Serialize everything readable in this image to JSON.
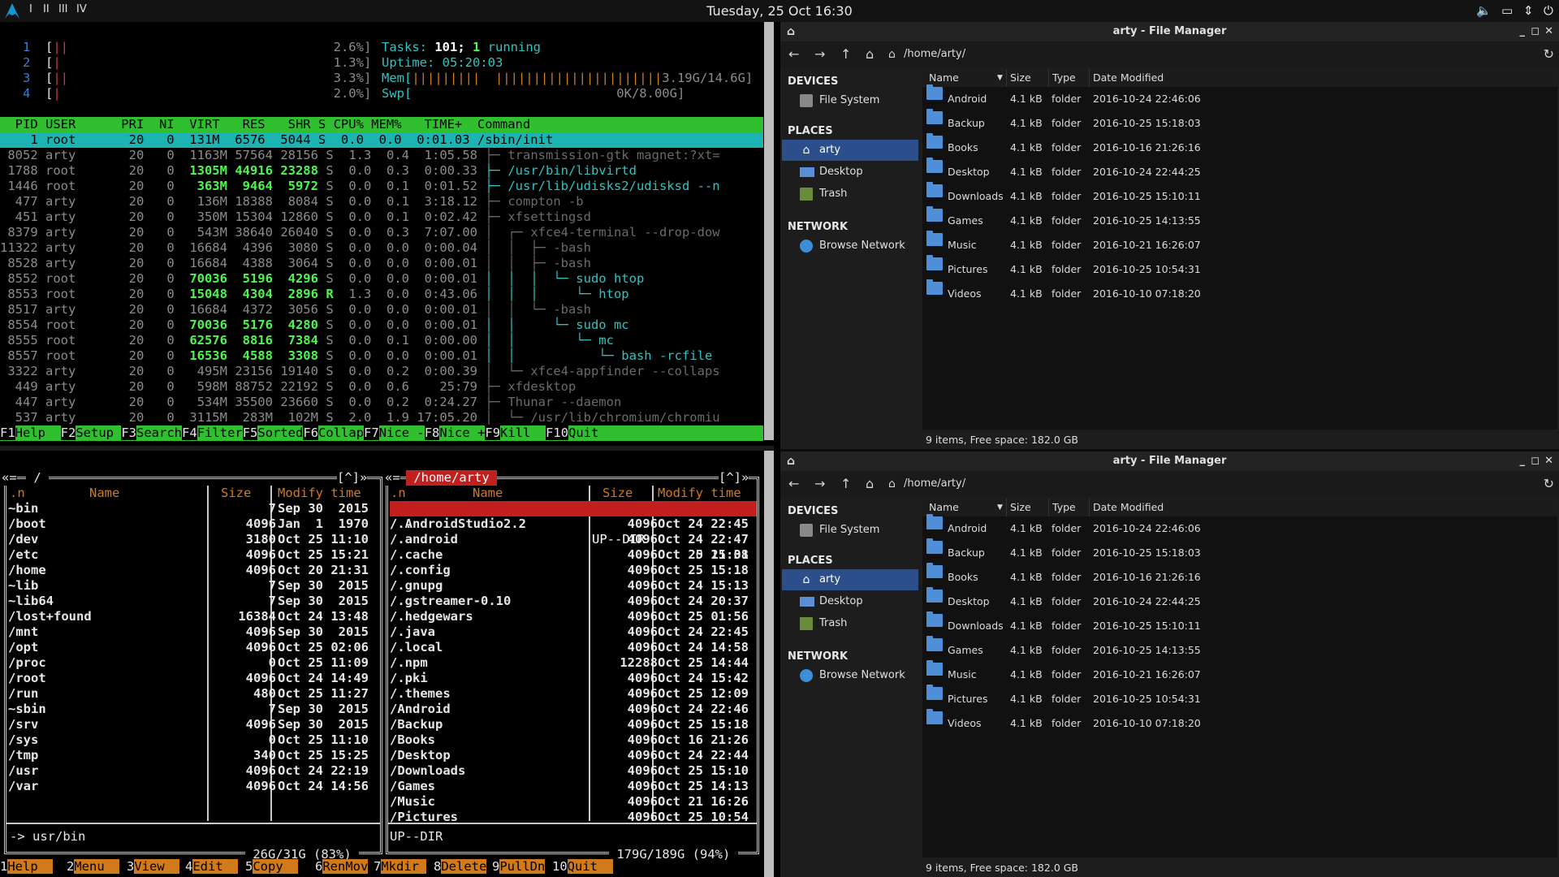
{
  "panel": {
    "workspaces": [
      "I",
      "II",
      "III",
      "IV"
    ],
    "clock": "Tuesday, 25 Oct  16:30",
    "tray": [
      "volume-icon",
      "display-icon",
      "network-icon",
      "power-icon"
    ]
  },
  "htop": {
    "meters": [
      {
        "cpu": "1",
        "bar": "||",
        "pct": "2.6%]"
      },
      {
        "cpu": "2",
        "bar": "|",
        "pct": "1.3%]"
      },
      {
        "cpu": "3",
        "bar": "||",
        "pct": "3.3%]"
      },
      {
        "cpu": "4",
        "bar": "|",
        "pct": "2.0%]"
      }
    ],
    "tasks_label": "Tasks: ",
    "tasks_value": "101; ",
    "running_value": "1",
    "running_label": " running",
    "uptime_label": "Uptime: ",
    "uptime_value": "05:20:03",
    "mem_label": "Mem[",
    "mem_bar": "|||||||||  ||||||||||||||||||||||",
    "mem_value": "3.19G/14.6G]",
    "swp_label": "Swp[",
    "swp_value": "0K/8.00G]",
    "header": "  PID USER      PRI  NI  VIRT   RES   SHR S CPU% MEM%   TIME+  Command",
    "selected_row": "    1 root       20   0  131M  6576  5044 S  0.0  0.0  0:01.03 /sbin/init",
    "rows": [
      {
        "pid": " 8052",
        "user": "arty",
        "pri": "20",
        "ni": "0",
        "virt": "1163M",
        "res": "57564",
        "shr": "28156",
        "s": "S",
        "cpu": "1.3",
        "mem": "0.4",
        "time": "1:05.58",
        "cmd": "├─ transmission-gtk magnet:?xt="
      },
      {
        "pid": " 1788",
        "user": "root",
        "pri": "20",
        "ni": "0",
        "virt": "1305M",
        "res": "44916",
        "shr": "23288",
        "s": "S",
        "cpu": "0.0",
        "mem": "0.3",
        "time": "0:00.33",
        "cmd": "├─ /usr/bin/libvirtd"
      },
      {
        "pid": " 1446",
        "user": "root",
        "pri": "20",
        "ni": "0",
        "virt": "363M",
        "res": "9464",
        "shr": "5972",
        "s": "S",
        "cpu": "0.0",
        "mem": "0.1",
        "time": "0:01.52",
        "cmd": "├─ /usr/lib/udisks2/udisksd --n"
      },
      {
        "pid": "  477",
        "user": "arty",
        "pri": "20",
        "ni": "0",
        "virt": "136M",
        "res": "18388",
        "shr": "8084",
        "s": "S",
        "cpu": "0.0",
        "mem": "0.1",
        "time": "3:18.12",
        "cmd": "├─ compton -b"
      },
      {
        "pid": "  451",
        "user": "arty",
        "pri": "20",
        "ni": "0",
        "virt": "350M",
        "res": "15304",
        "shr": "12860",
        "s": "S",
        "cpu": "0.0",
        "mem": "0.1",
        "time": "0:02.42",
        "cmd": "├─ xfsettingsd"
      },
      {
        "pid": " 8379",
        "user": "arty",
        "pri": "20",
        "ni": "0",
        "virt": "543M",
        "res": "38640",
        "shr": "26040",
        "s": "S",
        "cpu": "0.0",
        "mem": "0.3",
        "time": "7:07.00",
        "cmd": "│  ┌─ xfce4-terminal --drop-dow"
      },
      {
        "pid": "11322",
        "user": "arty",
        "pri": "20",
        "ni": "0",
        "virt": "16684",
        "res": "4396",
        "shr": "3080",
        "s": "S",
        "cpu": "0.0",
        "mem": "0.0",
        "time": "0:00.04",
        "cmd": "│  │  ├─ -bash"
      },
      {
        "pid": " 8528",
        "user": "arty",
        "pri": "20",
        "ni": "0",
        "virt": "16684",
        "res": "4388",
        "shr": "3064",
        "s": "S",
        "cpu": "0.0",
        "mem": "0.0",
        "time": "0:00.01",
        "cmd": "│  │  ├─ -bash"
      },
      {
        "pid": " 8552",
        "user": "root",
        "pri": "20",
        "ni": "0",
        "virt": "70036",
        "res": "5196",
        "shr": "4296",
        "s": "S",
        "cpu": "0.0",
        "mem": "0.0",
        "time": "0:00.01",
        "cmd": "│  │  │  └─ sudo htop"
      },
      {
        "pid": " 8553",
        "user": "root",
        "pri": "20",
        "ni": "0",
        "virt": "15048",
        "res": "4304",
        "shr": "2896",
        "s": "R",
        "cpu": "1.3",
        "mem": "0.0",
        "time": "0:43.06",
        "cmd": "│  │  │     └─ htop"
      },
      {
        "pid": " 8517",
        "user": "arty",
        "pri": "20",
        "ni": "0",
        "virt": "16684",
        "res": "4372",
        "shr": "3056",
        "s": "S",
        "cpu": "0.0",
        "mem": "0.0",
        "time": "0:00.01",
        "cmd": "│  │  └─ -bash"
      },
      {
        "pid": " 8554",
        "user": "root",
        "pri": "20",
        "ni": "0",
        "virt": "70036",
        "res": "5176",
        "shr": "4280",
        "s": "S",
        "cpu": "0.0",
        "mem": "0.0",
        "time": "0:00.01",
        "cmd": "│  │     └─ sudo mc"
      },
      {
        "pid": " 8555",
        "user": "root",
        "pri": "20",
        "ni": "0",
        "virt": "62576",
        "res": "8816",
        "shr": "7384",
        "s": "S",
        "cpu": "0.0",
        "mem": "0.1",
        "time": "0:00.00",
        "cmd": "│  │        └─ mc"
      },
      {
        "pid": " 8557",
        "user": "root",
        "pri": "20",
        "ni": "0",
        "virt": "16536",
        "res": "4588",
        "shr": "3308",
        "s": "S",
        "cpu": "0.0",
        "mem": "0.0",
        "time": "0:00.01",
        "cmd": "│  │           └─ bash -rcfile"
      },
      {
        "pid": " 3322",
        "user": "arty",
        "pri": "20",
        "ni": "0",
        "virt": "495M",
        "res": "23156",
        "shr": "19140",
        "s": "S",
        "cpu": "0.0",
        "mem": "0.2",
        "time": "0:00.39",
        "cmd": "│  └─ xfce4-appfinder --collaps"
      },
      {
        "pid": "  449",
        "user": "arty",
        "pri": "20",
        "ni": "0",
        "virt": "598M",
        "res": "88752",
        "shr": "22192",
        "s": "S",
        "cpu": "0.0",
        "mem": "0.6",
        "time": "25:79",
        "cmd": "├─ xfdesktop"
      },
      {
        "pid": "  447",
        "user": "arty",
        "pri": "20",
        "ni": "0",
        "virt": "534M",
        "res": "35500",
        "shr": "23660",
        "s": "S",
        "cpu": "0.0",
        "mem": "0.2",
        "time": "0:24.27",
        "cmd": "├─ Thunar --daemon"
      },
      {
        "pid": "  537",
        "user": "arty",
        "pri": "20",
        "ni": "0",
        "virt": "3115M",
        "res": "283M",
        "shr": "102M",
        "s": "S",
        "cpu": "2.0",
        "mem": "1.9",
        "time": "17:05.20",
        "cmd": "│  └─ /usr/lib/chromium/chromiu"
      }
    ],
    "fkeys": [
      {
        "k": "F1",
        "v": "Help  "
      },
      {
        "k": "F2",
        "v": "Setup "
      },
      {
        "k": "F3",
        "v": "Search"
      },
      {
        "k": "F4",
        "v": "Filter"
      },
      {
        "k": "F5",
        "v": "Sorted"
      },
      {
        "k": "F6",
        "v": "Collap"
      },
      {
        "k": "F7",
        "v": "Nice -"
      },
      {
        "k": "F8",
        "v": "Nice +"
      },
      {
        "k": "F9",
        "v": "Kill  "
      },
      {
        "k": "F10",
        "v": "Quit  "
      }
    ]
  },
  "mc": {
    "left": {
      "path": " / ",
      "nav": "[^]»",
      "cols": {
        "sort": ".n",
        "name": "Name",
        "size": "Size",
        "mtime": "Modify time"
      },
      "rows": [
        [
          "~bin",
          "7",
          "Sep 30  2015"
        ],
        [
          "/boot",
          "4096",
          "Jan  1  1970"
        ],
        [
          "/dev",
          "3180",
          "Oct 25 11:10"
        ],
        [
          "/etc",
          "4096",
          "Oct 25 15:21"
        ],
        [
          "/home",
          "4096",
          "Oct 20 21:31"
        ],
        [
          "~lib",
          "7",
          "Sep 30  2015"
        ],
        [
          "~lib64",
          "7",
          "Sep 30  2015"
        ],
        [
          "/lost+found",
          "16384",
          "Oct 24 13:48"
        ],
        [
          "/mnt",
          "4096",
          "Sep 30  2015"
        ],
        [
          "/opt",
          "4096",
          "Oct 25 02:06"
        ],
        [
          "/proc",
          "0",
          "Oct 25 11:09"
        ],
        [
          "/root",
          "4096",
          "Oct 24 14:49"
        ],
        [
          "/run",
          "480",
          "Oct 25 11:27"
        ],
        [
          "~sbin",
          "7",
          "Sep 30  2015"
        ],
        [
          "/srv",
          "4096",
          "Sep 30  2015"
        ],
        [
          "/sys",
          "0",
          "Oct 25 11:10"
        ],
        [
          "/tmp",
          "340",
          "Oct 25 15:25"
        ],
        [
          "/usr",
          "4096",
          "Oct 24 22:19"
        ],
        [
          "/var",
          "4096",
          "Oct 24 14:56"
        ]
      ],
      "status": "-> usr/bin",
      "free": " 26G/31G (83%) "
    },
    "right": {
      "path": " /home/arty ",
      "nav": "[^]»",
      "cols": {
        "sort": ".n",
        "name": "Name",
        "size": "Size",
        "mtime": "Modify time"
      },
      "selected": [
        "/..",
        "UP--DIR",
        "Oct 20 21:31"
      ],
      "rows": [
        [
          "/.AndroidStudio2.2",
          "4096",
          "Oct 24 22:45"
        ],
        [
          "/.android",
          "4096",
          "Oct 24 22:47"
        ],
        [
          "/.cache",
          "4096",
          "Oct 25 15:08"
        ],
        [
          "/.config",
          "4096",
          "Oct 25 15:18"
        ],
        [
          "/.gnupg",
          "4096",
          "Oct 24 15:13"
        ],
        [
          "/.gstreamer-0.10",
          "4096",
          "Oct 24 20:37"
        ],
        [
          "/.hedgewars",
          "4096",
          "Oct 25 01:56"
        ],
        [
          "/.java",
          "4096",
          "Oct 24 22:45"
        ],
        [
          "/.local",
          "4096",
          "Oct 24 14:58"
        ],
        [
          "/.npm",
          "12288",
          "Oct 25 14:44"
        ],
        [
          "/.pki",
          "4096",
          "Oct 24 15:42"
        ],
        [
          "/.themes",
          "4096",
          "Oct 25 12:09"
        ],
        [
          "/Android",
          "4096",
          "Oct 24 22:46"
        ],
        [
          "/Backup",
          "4096",
          "Oct 25 15:18"
        ],
        [
          "/Books",
          "4096",
          "Oct 16 21:26"
        ],
        [
          "/Desktop",
          "4096",
          "Oct 24 22:44"
        ],
        [
          "/Downloads",
          "4096",
          "Oct 25 15:10"
        ],
        [
          "/Games",
          "4096",
          "Oct 25 14:13"
        ],
        [
          "/Music",
          "4096",
          "Oct 21 16:26"
        ],
        [
          "/Pictures",
          "4096",
          "Oct 25 10:54"
        ]
      ],
      "status": "UP--DIR",
      "free": " 179G/189G (94%) "
    },
    "fkeys": [
      {
        "n": "1",
        "b": "Help  "
      },
      {
        "n": "2",
        "b": "Menu  "
      },
      {
        "n": "3",
        "b": "View  "
      },
      {
        "n": "4",
        "b": "Edit  "
      },
      {
        "n": "5",
        "b": "Copy  "
      },
      {
        "n": "6",
        "b": "RenMov"
      },
      {
        "n": "7",
        "b": "Mkdir "
      },
      {
        "n": "8",
        "b": "Delete"
      },
      {
        "n": "9",
        "b": "PullDn"
      },
      {
        "n": "10",
        "b": "Quit  "
      }
    ]
  },
  "file_manager": {
    "title": "arty - File Manager",
    "path": "/home/arty/",
    "sections": {
      "devices": "DEVICES",
      "places": "PLACES",
      "network": "NETWORK"
    },
    "devices": [
      "File System"
    ],
    "places": [
      "arty",
      "Desktop",
      "Trash"
    ],
    "network": [
      "Browse Network"
    ],
    "columns": {
      "name": "Name",
      "size": "Size",
      "type": "Type",
      "date": "Date Modified"
    },
    "rows": [
      {
        "name": "Android",
        "size": "4.1 kB",
        "type": "folder",
        "date": "2016-10-24 22:46:06"
      },
      {
        "name": "Backup",
        "size": "4.1 kB",
        "type": "folder",
        "date": "2016-10-25 15:18:03"
      },
      {
        "name": "Books",
        "size": "4.1 kB",
        "type": "folder",
        "date": "2016-10-16 21:26:16"
      },
      {
        "name": "Desktop",
        "size": "4.1 kB",
        "type": "folder",
        "date": "2016-10-24 22:44:25"
      },
      {
        "name": "Downloads",
        "size": "4.1 kB",
        "type": "folder",
        "date": "2016-10-25 15:10:11"
      },
      {
        "name": "Games",
        "size": "4.1 kB",
        "type": "folder",
        "date": "2016-10-25 14:13:55"
      },
      {
        "name": "Music",
        "size": "4.1 kB",
        "type": "folder",
        "date": "2016-10-21 16:26:07"
      },
      {
        "name": "Pictures",
        "size": "4.1 kB",
        "type": "folder",
        "date": "2016-10-25 10:54:31"
      },
      {
        "name": "Videos",
        "size": "4.1 kB",
        "type": "folder",
        "date": "2016-10-10 07:18:20"
      }
    ],
    "status": "9 items, Free space: 182.0 GB"
  },
  "colors": {
    "accent": "#2c4f8c",
    "htop_green": "#2fbf2f",
    "mc_orange": "#d07a1c",
    "mc_red": "#c21f1f",
    "folder": "#4f8fd8"
  }
}
